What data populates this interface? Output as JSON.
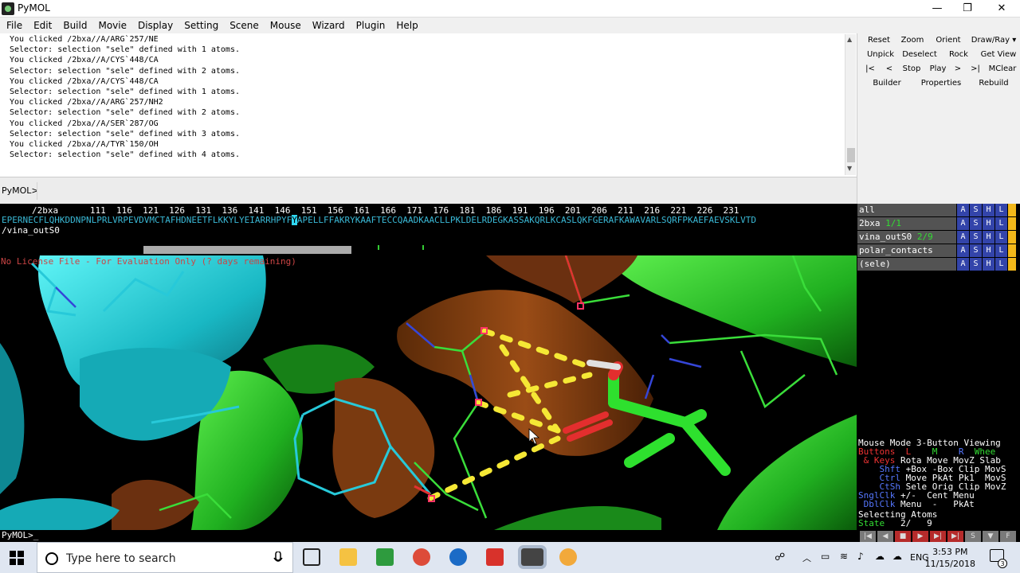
{
  "window": {
    "title": "PyMOL",
    "min": "—",
    "max": "❐",
    "close": "✕"
  },
  "menu": [
    "File",
    "Edit",
    "Build",
    "Movie",
    "Display",
    "Setting",
    "Scene",
    "Mouse",
    "Wizard",
    "Plugin",
    "Help"
  ],
  "console": {
    "lines": "You clicked /2bxa//A/ARG`257/NE\nSelector: selection \"sele\" defined with 1 atoms.\nYou clicked /2bxa//A/CYS`448/CA\nSelector: selection \"sele\" defined with 2 atoms.\nYou clicked /2bxa//A/CYS`448/CA\nSelector: selection \"sele\" defined with 1 atoms.\nYou clicked /2bxa//A/ARG`257/NH2\nSelector: selection \"sele\" defined with 2 atoms.\nYou clicked /2bxa//A/SER`287/OG\nSelector: selection \"sele\" defined with 3 atoms.\nYou clicked /2bxa//A/TYR`150/OH\nSelector: selection \"sele\" defined with 4 atoms.",
    "prompt": "PyMOL>",
    "bottom_prompt": "PyMOL>_"
  },
  "panel_buttons": {
    "row1": [
      "Reset",
      "Zoom",
      "Orient",
      "Draw/Ray"
    ],
    "row2": [
      "Unpick",
      "Deselect",
      "Rock",
      "Get View"
    ],
    "row3": [
      "|<",
      "<",
      "Stop",
      "Play",
      ">",
      ">|",
      "MClear"
    ],
    "row4": [
      "Builder",
      "Properties",
      "Rebuild"
    ]
  },
  "sequence": {
    "numbers": "/2bxa      111  116  121  126  131  136  141  146  151  156  161  166  171  176  181  186  191  196  201  206  211  216  221  226  231",
    "seq_pre": "EPERNECFLQHKDDNPNLPRLVRPEVDVMCTAFHDNEETFLKKYLYEIARRHPYF",
    "seq_sel": "Y",
    "seq_post": "APELLFFAKRYKAAFTECCQAADKAACLLPKLDELRDEGKASSAKQRLKCASLQKFGERAFKAWAVARLSQRFPKAEFAEVSKLVTD",
    "object": "/vina_outS0"
  },
  "license": "No License File - For Evaluation Only (? days remaining)",
  "objects": [
    {
      "name": "all",
      "count": ""
    },
    {
      "name": "2bxa",
      "count": "1/1"
    },
    {
      "name": "vina_outS0",
      "count": "2/9"
    },
    {
      "name": "polar_contacts",
      "count": ""
    },
    {
      "name": "(sele)",
      "count": ""
    }
  ],
  "obj_buttons": [
    "A",
    "S",
    "H",
    "L"
  ],
  "mouse_mode": {
    "title": "Mouse Mode 3-Button Viewing",
    "buttons": "Buttons",
    "l": "L",
    "m": "M",
    "r": "R",
    "wheel": "Whee",
    "keys": "& Keys",
    "rows": [
      {
        "k": "Rota Move MovZ Slab",
        "lbl": "& Keys"
      },
      {
        "k": "+Box -Box Clip MovS",
        "lbl": "Shft"
      },
      {
        "k": "Move PkAt Pk1  MovS",
        "lbl": "Ctrl"
      },
      {
        "k": "Sele Orig Clip MovZ",
        "lbl": "CtSh"
      },
      {
        "k": "+/-  Cent Menu",
        "lbl": "SnglClk"
      },
      {
        "k": "Menu  -   PkAt",
        "lbl": "DblClk"
      }
    ],
    "selecting": "Selecting Atoms",
    "state_label": "State",
    "state_value": "2/   9"
  },
  "playbar": [
    "|◀",
    "◀",
    "■",
    "▶",
    "▶|",
    "▶|",
    "S",
    "▼",
    "F"
  ],
  "taskbar": {
    "search_placeholder": "Type here to search",
    "time": "3:53 PM",
    "date": "11/15/2018",
    "lang": "ENG",
    "notif": "3"
  },
  "colors": {
    "cyan": "#1ec8d2",
    "green": "#33dd33",
    "brown": "#8b4513",
    "yellow": "#f3e535"
  }
}
